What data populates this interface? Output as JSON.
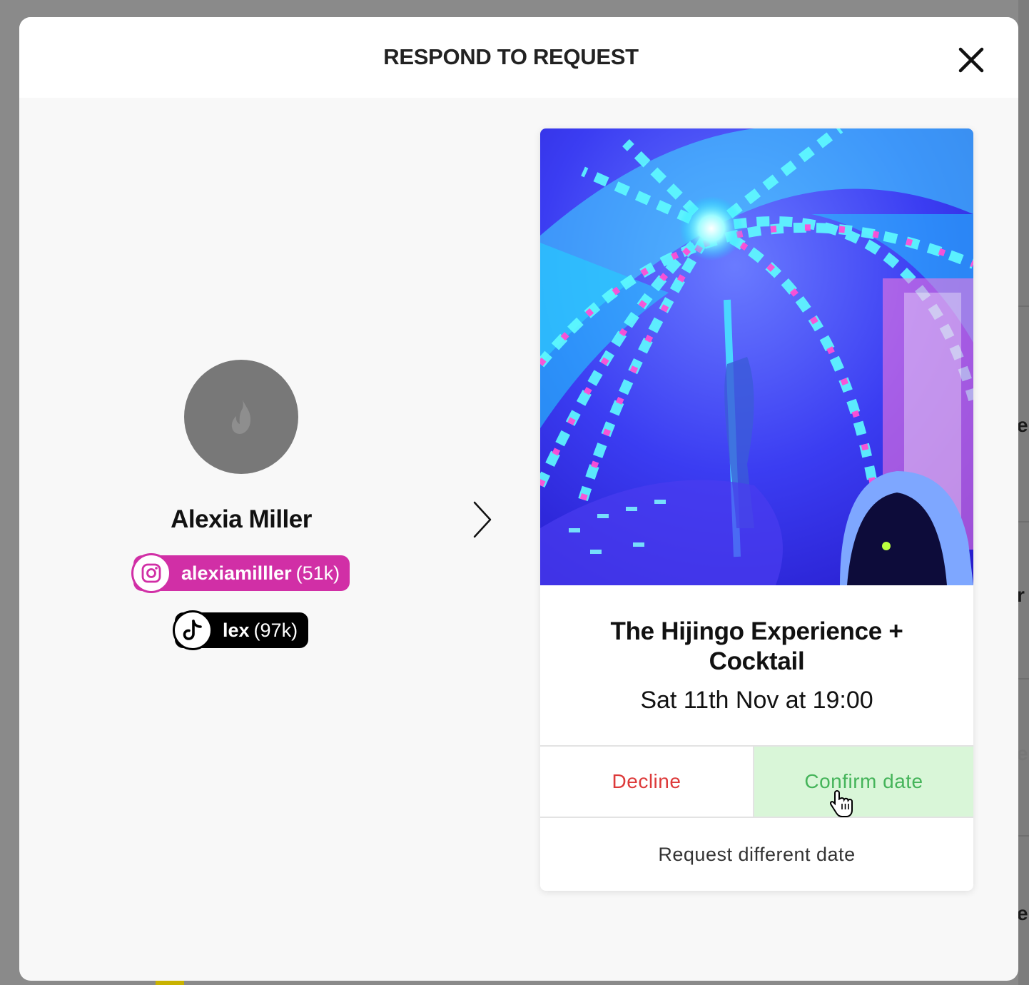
{
  "modal": {
    "title": "RESPOND TO REQUEST",
    "close_icon": "close-icon"
  },
  "profile": {
    "avatar_icon": "flame-icon",
    "name": "Alexia Miller",
    "socials": [
      {
        "platform": "instagram",
        "icon": "instagram-icon",
        "handle": "alexiamilller",
        "count": "(51k)",
        "color": "#d12fa6"
      },
      {
        "platform": "tiktok",
        "icon": "tiktok-icon",
        "handle": "lex",
        "count": "(97k)",
        "color": "#000000"
      }
    ]
  },
  "navigation": {
    "next_icon": "chevron-right-icon"
  },
  "event": {
    "title": "The Hijingo Experience + Cocktail",
    "date": "Sat 11th Nov at 19:00",
    "actions": {
      "decline": "Decline",
      "confirm": "Confirm date",
      "request_different": "Request different date"
    }
  },
  "colors": {
    "decline": "#dd3a3a",
    "confirm": "#45b45a",
    "confirm_bg": "#d9f6d8",
    "instagram": "#d12fa6"
  }
}
